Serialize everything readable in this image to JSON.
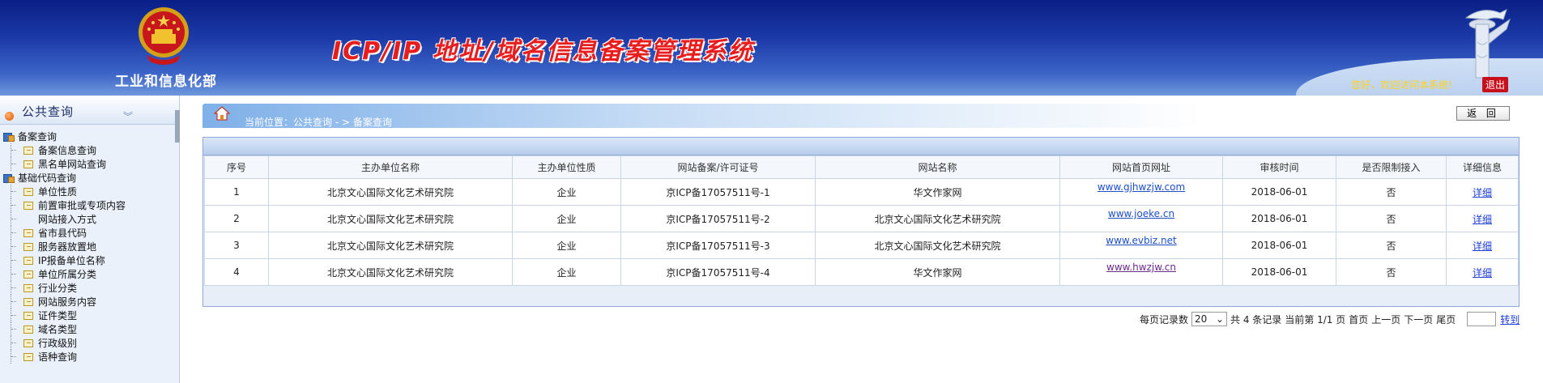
{
  "header": {
    "ministry": "工业和信息化部",
    "system_title": "ICP/IP 地址/域名信息备案管理系统",
    "welcome": "您好，欢迎访问本系统!",
    "logout": "退出"
  },
  "sidebar": {
    "title": "公共查询",
    "collapse_glyph": "︾",
    "groups": [
      {
        "label": "备案查询",
        "items": [
          "备案信息查询",
          "黑名单网站查询"
        ]
      },
      {
        "label": "基础代码查询",
        "items": [
          "单位性质",
          "前置审批或专项内容",
          "网站接入方式",
          "省市县代码",
          "服务器放置地",
          "IP报备单位名称",
          "单位所属分类",
          "行业分类",
          "网站服务内容",
          "证件类型",
          "域名类型",
          "行政级别",
          "语种查询"
        ]
      }
    ]
  },
  "breadcrumb": {
    "text": "当前位置：公共查询  - >  备案查询"
  },
  "back_button": "返 回",
  "table": {
    "columns": [
      "序号",
      "主办单位名称",
      "主办单位性质",
      "网站备案/许可证号",
      "网站名称",
      "网站首页网址",
      "审核时间",
      "是否限制接入",
      "详细信息"
    ],
    "rows": [
      [
        "1",
        "北京文心国际文化艺术研究院",
        "企业",
        "京ICP备17057511号-1",
        "华文作家网",
        "www.gjhwzjw.com",
        "2018-06-01",
        "否",
        "详细"
      ],
      [
        "2",
        "北京文心国际文化艺术研究院",
        "企业",
        "京ICP备17057511号-2",
        "北京文心国际文化艺术研究院",
        "www.joeke.cn",
        "2018-06-01",
        "否",
        "详细"
      ],
      [
        "3",
        "北京文心国际文化艺术研究院",
        "企业",
        "京ICP备17057511号-3",
        "北京文心国际文化艺术研究院",
        "www.evbiz.net",
        "2018-06-01",
        "否",
        "详细"
      ],
      [
        "4",
        "北京文心国际文化艺术研究院",
        "企业",
        "京ICP备17057511号-4",
        "华文作家网",
        "www.hwzjw.cn",
        "2018-06-01",
        "否",
        "详细"
      ]
    ]
  },
  "pager": {
    "per_page_label": "每页记录数",
    "per_page_value": "20",
    "total": "共 4 条记录",
    "current": "当前第 1/1 页",
    "first": "首页",
    "prev": "上一页",
    "next": "下一页",
    "last": "尾页",
    "goto": "转到"
  },
  "colors": {
    "header_dark": "#0a1f86",
    "title_red": "#e81e1e",
    "welcome_yellow": "#ffd21a",
    "link_blue": "#1d4fc7"
  },
  "icons": [
    "national-emblem-icon",
    "huabiao-pillar-icon",
    "home-icon",
    "folder-icon",
    "page-icon"
  ]
}
